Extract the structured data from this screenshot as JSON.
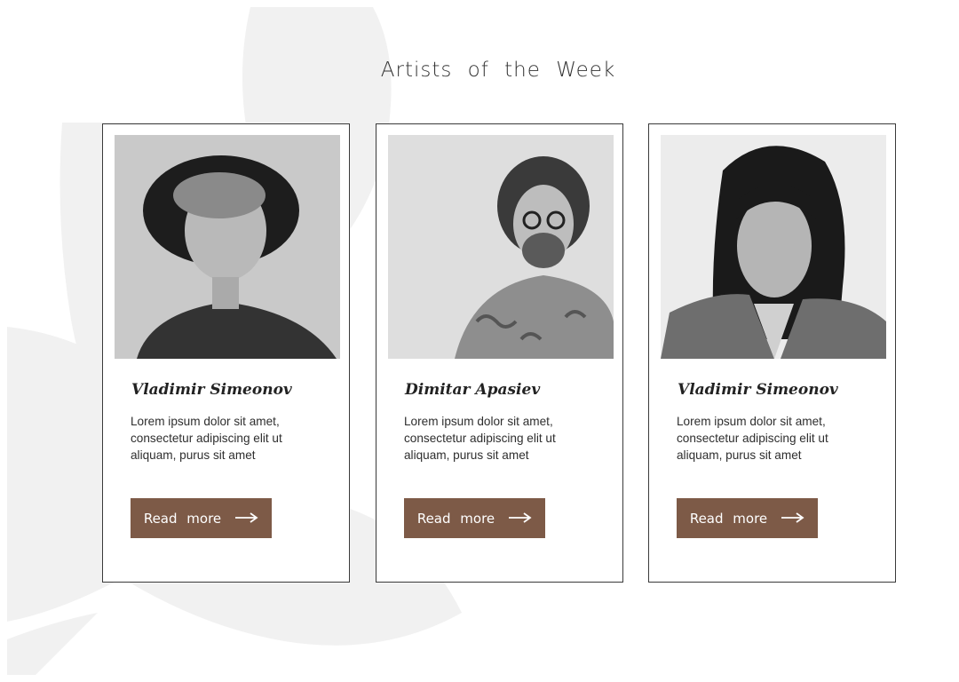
{
  "section": {
    "title": "Artists of the Week"
  },
  "theme": {
    "accent": "#7d5a47",
    "card_border": "#3a3a3a",
    "decor": "#f1f1f1"
  },
  "cards": [
    {
      "name": "Vladimir Simeonov",
      "description": "Lorem ipsum dolor sit amet, consectetur adipiscing elit ut aliquam, purus sit amet",
      "button_label": "Read more",
      "button_icon": "arrow-right-icon"
    },
    {
      "name": "Dimitar Apasiev",
      "description": "Lorem ipsum dolor sit amet, consectetur adipiscing elit ut aliquam, purus sit amet",
      "button_label": "Read more",
      "button_icon": "arrow-right-icon"
    },
    {
      "name": "Vladimir Simeonov",
      "description": "Lorem ipsum dolor sit amet, consectetur adipiscing elit ut aliquam, purus sit amet",
      "button_label": "Read more",
      "button_icon": "arrow-right-icon"
    }
  ]
}
